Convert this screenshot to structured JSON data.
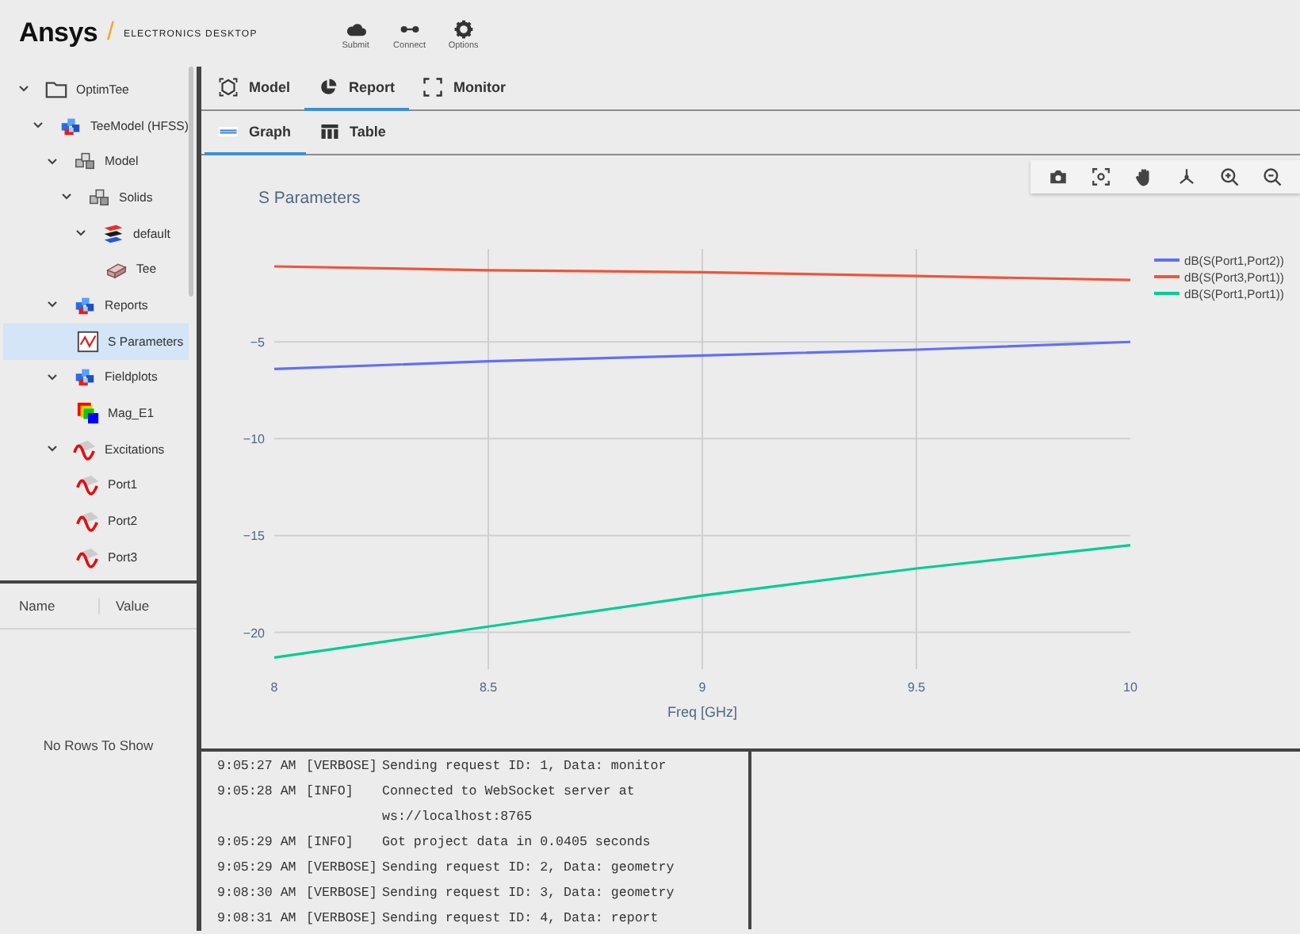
{
  "header": {
    "brand": "Ansys",
    "separator": "/",
    "product": "ELECTRONICS DESKTOP",
    "actions": [
      {
        "kind": "cloud",
        "label": "Submit"
      },
      {
        "kind": "connect",
        "label": "Connect"
      },
      {
        "kind": "gear",
        "label": "Options"
      }
    ]
  },
  "tree": [
    {
      "kind": "folder",
      "label": "OptimTee",
      "expanded": true,
      "selected": false,
      "children": [
        {
          "kind": "design",
          "label": "TeeModel (HFSS)",
          "expanded": true,
          "selected": false,
          "children": [
            {
              "kind": "model",
              "label": "Model",
              "expanded": true,
              "selected": false,
              "children": [
                {
                  "kind": "model",
                  "label": "Solids",
                  "expanded": true,
                  "selected": false,
                  "children": [
                    {
                      "kind": "layers",
                      "label": "default",
                      "expanded": true,
                      "selected": false,
                      "children": [
                        {
                          "kind": "brick",
                          "label": "Tee",
                          "selected": false
                        }
                      ]
                    }
                  ]
                }
              ]
            },
            {
              "kind": "design",
              "label": "Reports",
              "expanded": true,
              "selected": false,
              "children": [
                {
                  "kind": "report",
                  "label": "S Parameters",
                  "selected": true
                }
              ]
            },
            {
              "kind": "design",
              "label": "Fieldplots",
              "expanded": true,
              "selected": false,
              "children": [
                {
                  "kind": "fieldplot",
                  "label": "Mag_E1",
                  "selected": false
                }
              ]
            },
            {
              "kind": "excitation",
              "label": "Excitations",
              "expanded": true,
              "selected": false,
              "children": [
                {
                  "kind": "excitation",
                  "label": "Port1",
                  "selected": false
                },
                {
                  "kind": "excitation",
                  "label": "Port2",
                  "selected": false
                },
                {
                  "kind": "excitation",
                  "label": "Port3",
                  "selected": false
                }
              ]
            }
          ]
        }
      ]
    }
  ],
  "properties": {
    "columns": [
      "Name",
      "Value"
    ],
    "empty_message": "No Rows To Show"
  },
  "tabs": [
    {
      "kind": "model",
      "label": "Model",
      "selected": false
    },
    {
      "kind": "report",
      "label": "Report",
      "selected": true
    },
    {
      "kind": "monitor",
      "label": "Monitor",
      "selected": false
    }
  ],
  "subtabs": [
    {
      "kind": "graph",
      "label": "Graph",
      "selected": true
    },
    {
      "kind": "table",
      "label": "Table",
      "selected": false
    }
  ],
  "chart": {
    "toolbar": [
      {
        "kind": "camera"
      },
      {
        "kind": "autoscale"
      },
      {
        "kind": "pan"
      },
      {
        "kind": "orbit"
      },
      {
        "kind": "zoom-in"
      },
      {
        "kind": "zoom-out"
      }
    ],
    "chart_data": {
      "type": "line",
      "title": "S Parameters",
      "xlabel": "Freq [GHz]",
      "x": [
        8,
        8.5,
        9,
        9.5,
        10
      ],
      "xlim": [
        8,
        10
      ],
      "ylim": [
        -21.9,
        -0.2
      ],
      "grid": true,
      "legend": true,
      "xticks": [
        8,
        8.5,
        9,
        9.5,
        10
      ],
      "yticks": [
        {
          "value": -5,
          "label": "−5"
        },
        {
          "value": -10,
          "label": "−10"
        },
        {
          "value": -15,
          "label": "−15"
        },
        {
          "value": -20,
          "label": "−20"
        }
      ],
      "series": [
        {
          "name": "dB(S(Port1,Port2))",
          "color": "#636efa",
          "values": [
            -6.4,
            -6.0,
            -5.7,
            -5.4,
            -5.0
          ]
        },
        {
          "name": "dB(S(Port3,Port1))",
          "color": "#ef553b",
          "values": [
            -1.1,
            -1.3,
            -1.4,
            -1.6,
            -1.8
          ]
        },
        {
          "name": "dB(S(Port1,Port1))",
          "color": "#00cc96",
          "values": [
            -21.3,
            -19.7,
            -18.1,
            -16.7,
            -15.5
          ]
        }
      ]
    }
  },
  "log": [
    {
      "time": "9:05:27 AM",
      "level": "[VERBOSE]",
      "message": "Sending request ID: 1, Data: monitor"
    },
    {
      "time": "9:05:28 AM",
      "level": "[INFO]",
      "message": "Connected to WebSocket server at ws://localhost:8765"
    },
    {
      "time": "9:05:29 AM",
      "level": "[INFO]",
      "message": "Got project data in 0.0405 seconds"
    },
    {
      "time": "9:05:29 AM",
      "level": "[VERBOSE]",
      "message": "Sending request ID: 2, Data: geometry"
    },
    {
      "time": "9:08:30 AM",
      "level": "[VERBOSE]",
      "message": "Sending request ID: 3, Data: geometry"
    },
    {
      "time": "9:08:31 AM",
      "level": "[VERBOSE]",
      "message": "Sending request ID: 4, Data: report"
    }
  ]
}
